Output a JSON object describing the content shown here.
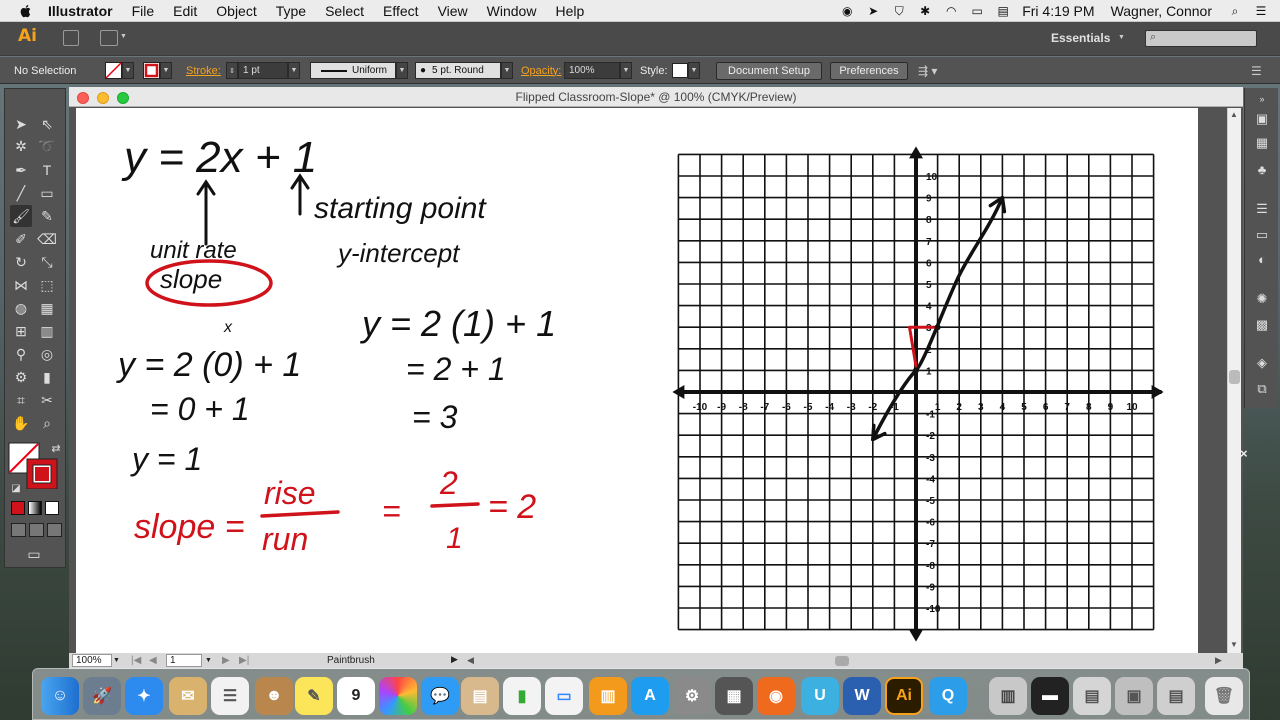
{
  "menubar": {
    "app": "Illustrator",
    "items": [
      "File",
      "Edit",
      "Object",
      "Type",
      "Select",
      "Effect",
      "View",
      "Window",
      "Help"
    ],
    "clock": "Fri 4:19 PM",
    "user": "Wagner, Connor"
  },
  "appbar": {
    "logo": "Ai",
    "workspace": "Essentials"
  },
  "control_bar": {
    "selection": "No Selection",
    "stroke_label": "Stroke:",
    "stroke_value": "1 pt",
    "profile": "Uniform",
    "brush": "5 pt. Round",
    "opacity_label": "Opacity:",
    "opacity_value": "100%",
    "style_label": "Style:",
    "document_setup": "Document Setup",
    "preferences": "Preferences"
  },
  "document": {
    "title": "Flipped Classroom-Slope* @ 100% (CMYK/Preview)",
    "zoom": "100%",
    "artboard": "1",
    "status_tool": "Paintbrush"
  },
  "handwriting": {
    "equation": "y = 2x + 1",
    "unit_rate": "unit rate",
    "slope_circled": "slope",
    "starting_point": "starting point",
    "y_intercept": "y-intercept",
    "calc_a1": "y = 2 (0) + 1",
    "calc_a_x": "x",
    "calc_a2": "= 0 + 1",
    "calc_a3": "y = 1",
    "calc_b1": "y = 2 (1) + 1",
    "calc_b2": "= 2 + 1",
    "calc_b3": "= 3",
    "slope_def": "slope =",
    "rise": "rise",
    "run": "run",
    "fraction_eq": "=",
    "num": "2",
    "den": "1",
    "result": "= 2"
  },
  "graph": {
    "x_ticks": [
      "-10",
      "-9",
      "-8",
      "-7",
      "-6",
      "-5",
      "-4",
      "-3",
      "-2",
      "-1",
      "1",
      "2",
      "3",
      "4",
      "5",
      "6",
      "7",
      "8",
      "9",
      "10"
    ],
    "y_ticks": [
      "10",
      "9",
      "8",
      "7",
      "6",
      "5",
      "4",
      "3",
      "2",
      "1",
      "-1",
      "-2",
      "-3",
      "-4",
      "-5",
      "-6",
      "-7",
      "-8",
      "-9",
      "-10"
    ]
  },
  "colors": {
    "ink_black": "#111111",
    "ink_red": "#d0121b",
    "ai_orange": "#f7a21b"
  }
}
